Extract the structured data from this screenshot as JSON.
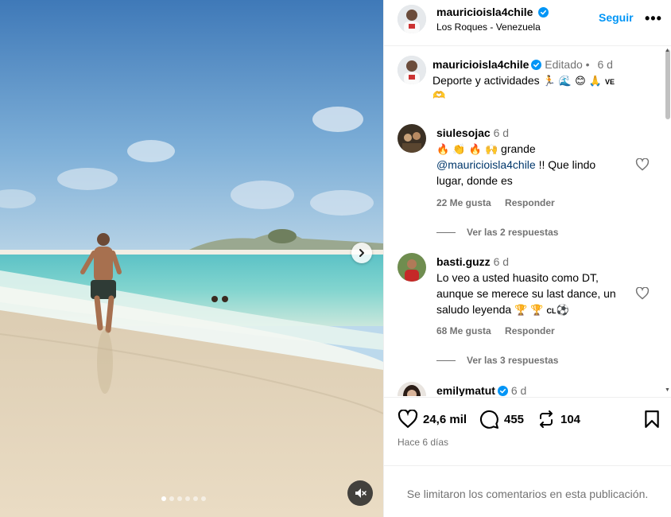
{
  "media": {
    "slide_count": 6,
    "active_slide": 0,
    "next_icon": "chevron-right-icon",
    "mute_icon": "speaker-muted-icon"
  },
  "header": {
    "username": "mauricioisla4chile",
    "location": "Los Roques - Venezuela",
    "follow_label": "Seguir",
    "more_label": "•••"
  },
  "caption": {
    "username": "mauricioisla4chile",
    "edited": "Editado",
    "separator": "•",
    "time": "6 d",
    "text": "Deporte  y actividades",
    "emojis": "🏃 🌊 😊 🙏",
    "flag": "VE",
    "heart_hands": "🫶"
  },
  "comments": [
    {
      "username": "siulesojac",
      "time": "6 d",
      "emojis": "🔥 👏 🔥 🙌",
      "text_a": "grande",
      "mention": "@mauricioisla4chile",
      "text_b": "!! Que lindo",
      "text_c": "lugar, donde es",
      "likes": "22 Me gusta",
      "reply_label": "Responder",
      "view_replies": "Ver las 2 respuestas"
    },
    {
      "username": "basti.guzz",
      "time": "6 d",
      "line1": "Lo veo a usted huasito como DT,",
      "line2": "aunque se merece su last dance, un",
      "line3": "saludo leyenda",
      "emojis": "🏆 🏆",
      "flag": "CL",
      "ball": "⚽",
      "likes": "68 Me gusta",
      "reply_label": "Responder",
      "view_replies": "Ver las 3 respuestas"
    },
    {
      "username": "emilymatut",
      "time": "6 d"
    }
  ],
  "actions": {
    "likes": "24,6 mil",
    "comments": "455",
    "reposts": "104",
    "time_ago": "Hace 6 días",
    "comments_limited": "Se limitaron los comentarios en esta publicación."
  },
  "colors": {
    "accent": "#0095f6",
    "verified": "#0095f6",
    "muted_text": "#737373",
    "mention": "#00376b"
  }
}
